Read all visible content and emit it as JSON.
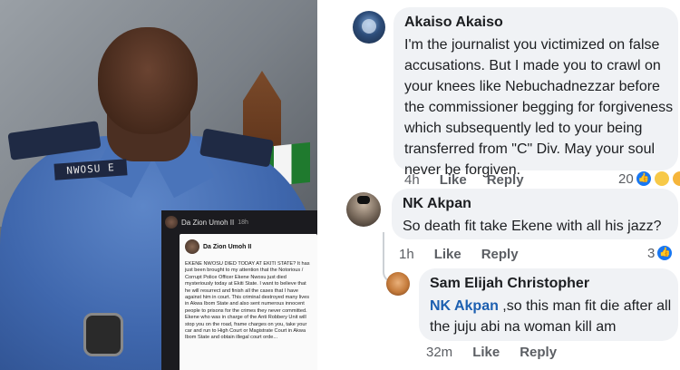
{
  "photo": {
    "nametag": "NWOSU E",
    "inset": {
      "poster_name": "Da Zion Umoh II",
      "poster_time": "18h",
      "card_name": "Da Zion Umoh II",
      "card_text": "EKENE NWOSU DIED TODAY AT EKITI STATE? It has just been brought to my attention that the Notorious / Corrupt Police Officer Ekene Nwosu just died mysteriously today at Ekiti State. I want to believe that he will resurrect and finish all the cases that I have against him in court. This criminal destroyed many lives in Akwa Ibom State and also sent numerous innocent people to prisons for the crimes they never committed. Ekene who was in charge of the Anti Robbery Unit will stop you on the road, frame charges on you, take your car and run to High Court or Magistrate Court in Akwa Ibom State and obtain illegal court orde..."
    }
  },
  "comments": [
    {
      "author": "Akaiso Akaiso",
      "text": "I'm the journalist you victimized on false accusations. But I made you to crawl on your knees like Nebuchadnezzar before the commissioner begging for forgiveness which subsequently led to your being transferred from \"C\" Div. May your soul never be forgiven.",
      "time": "4h",
      "like": "Like",
      "reply": "Reply",
      "reaction_count": "20"
    },
    {
      "author": "NK Akpan",
      "text": "So death fit take Ekene with all his jazz?",
      "time": "1h",
      "like": "Like",
      "reply": "Reply",
      "reaction_count": "3"
    },
    {
      "author": "Sam Elijah Christopher",
      "mention": "NK Akpan",
      "text": " ,so this man fit die after all the juju abi na woman kill am",
      "time": "32m",
      "like": "Like",
      "reply": "Reply"
    }
  ],
  "colors": {
    "bubble": "#f0f2f5",
    "mention": "#1c5fb0",
    "like_reaction": "#1877f2"
  }
}
